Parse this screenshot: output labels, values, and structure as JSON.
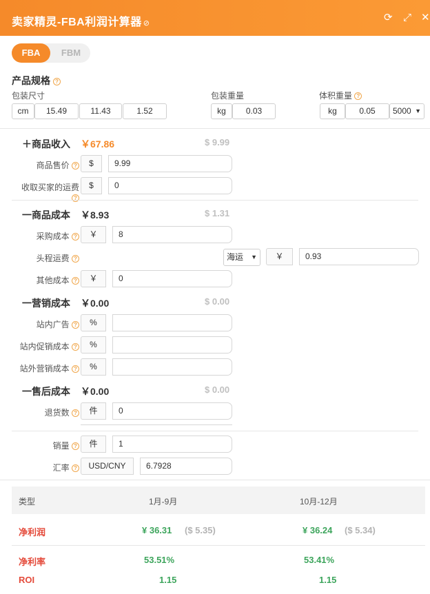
{
  "window": {
    "title": "卖家精灵-FBA利润计算器",
    "link_icon": "link-icon",
    "refresh_icon": "refresh-icon",
    "expand_icon": "expand-icon",
    "close_icon": "close-icon"
  },
  "mode": {
    "active": "FBA",
    "inactive": "FBM"
  },
  "spec": {
    "title": "产品规格",
    "package_size_label": "包装尺寸",
    "size_unit": "cm",
    "length": "15.49",
    "width": "11.43",
    "height": "1.52",
    "weight_label": "包装重量",
    "weight_unit": "kg",
    "weight": "0.03",
    "vol_weight_label": "体积重量",
    "vol_weight_unit": "kg",
    "vol_weight": "0.05",
    "divisor": "5000"
  },
  "revenue": {
    "sign": "＋",
    "title": "商品收入",
    "value": "￥67.86",
    "usd": "$ 9.99",
    "price_label": "商品售价",
    "price_currency": "$",
    "price": "9.99",
    "shipping_label": "收取买家的运费",
    "shipping_currency": "$",
    "shipping": "0"
  },
  "cost": {
    "sign": "一",
    "title": "商品成本",
    "value": "￥8.93",
    "usd": "$ 1.31",
    "purchase_label": "采购成本",
    "purchase_currency": "￥",
    "purchase": "8",
    "freight_label": "头程运费",
    "freight_mode": "海运",
    "freight_currency": "￥",
    "freight": "0.93",
    "other_label": "其他成本",
    "other_currency": "￥",
    "other": "0"
  },
  "marketing": {
    "sign": "一",
    "title": "营销成本",
    "value": "￥0.00",
    "usd": "$ 0.00",
    "ads_label": "站内广告",
    "ads_unit": "%",
    "ads": "",
    "promo_label": "站内促销成本",
    "promo_unit": "%",
    "promo": "",
    "external_label": "站外营销成本",
    "external_unit": "%",
    "external": ""
  },
  "aftersale": {
    "sign": "一",
    "title": "售后成本",
    "value": "￥0.00",
    "usd": "$ 0.00",
    "returns_label": "退货数",
    "returns_unit": "件",
    "returns": "0"
  },
  "sales": {
    "volume_label": "销量",
    "volume_unit": "件",
    "volume": "1",
    "rate_label": "汇率",
    "rate_pair": "USD/CNY",
    "rate": "6.7928"
  },
  "results": {
    "col_type": "类型",
    "col_period1": "1月-9月",
    "col_period2": "10月-12月",
    "rows": [
      {
        "label": "净利润",
        "p1": "¥ 36.31",
        "p1_usd": "($ 5.35)",
        "p2": "¥ 36.24",
        "p2_usd": "($ 5.34)"
      },
      {
        "label": "净利率",
        "p1": "53.51%",
        "p2": "53.41%"
      },
      {
        "label": "ROI",
        "p1": "1.15",
        "p2": "1.15"
      }
    ]
  },
  "colors": {
    "accent": "#f58a2a",
    "profit_red": "#e44a3a",
    "value_green": "#3da55c"
  }
}
